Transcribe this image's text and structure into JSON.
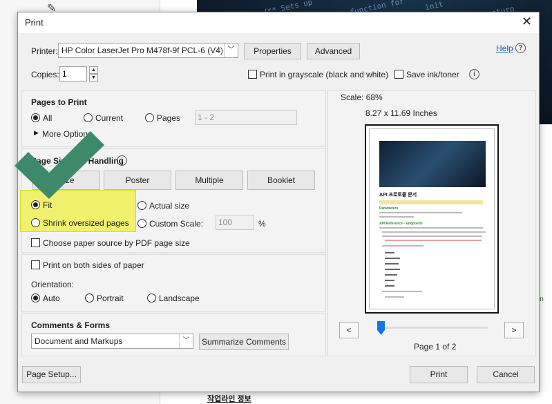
{
  "background": {
    "footer_link": "작업라인 정보",
    "right_text": "in",
    "code_lines": [
      "/** Sets up",
      "* this function for",
      "init",
      "return"
    ]
  },
  "dialog": {
    "title": "Print",
    "close_glyph": "✕"
  },
  "printer": {
    "label": "Printer:",
    "value": "HP Color LaserJet Pro M478f-9f PCL-6 (V4)",
    "properties_label": "Properties",
    "advanced_label": "Advanced",
    "help_label": "Help",
    "help_icon": "?"
  },
  "copies": {
    "label": "Copies:",
    "value": "1",
    "grayscale_label": "Print in grayscale (black and white)",
    "grayscale_checked": false,
    "save_ink_label": "Save ink/toner",
    "save_ink_checked": false,
    "info_icon": "i"
  },
  "pages_to_print": {
    "title": "Pages to Print",
    "all_label": "All",
    "current_label": "Current",
    "pages_label": "Pages",
    "pages_value": "1 - 2",
    "selected": "All",
    "more_options_label": "More Options"
  },
  "sizing": {
    "title": "Page Sizing & Handling",
    "info_icon": "i",
    "tabs": [
      "Size",
      "Poster",
      "Multiple",
      "Booklet"
    ],
    "fit_label": "Fit",
    "actual_size_label": "Actual size",
    "shrink_label": "Shrink oversized pages",
    "custom_scale_label": "Custom Scale:",
    "custom_scale_value": "100",
    "custom_scale_unit": "%",
    "selected": "Fit",
    "paper_source_label": "Choose paper source by PDF page size",
    "paper_source_checked": false
  },
  "duplex": {
    "both_sides_label": "Print on both sides of paper",
    "both_sides_checked": false,
    "orientation_label": "Orientation:",
    "auto_label": "Auto",
    "portrait_label": "Portrait",
    "landscape_label": "Landscape",
    "selected": "Auto"
  },
  "comments": {
    "title": "Comments & Forms",
    "value": "Document and Markups",
    "summarize_label": "Summarize Comments"
  },
  "preview": {
    "scale": "Scale:  68%",
    "size": "8.27 x 11.69 Inches",
    "page_indicator": "Page 1 of 2",
    "prev_label": "<",
    "next_label": ">",
    "position_fraction": 0.0,
    "doc_title": "API 프로토콜 문서",
    "doc_section1": "Parameters",
    "doc_section2": "API Reference - Endpoints"
  },
  "footer": {
    "page_setup_label": "Page Setup...",
    "print_label": "Print",
    "cancel_label": "Cancel"
  },
  "colors": {
    "highlight": "#f0f046",
    "checkmark": "#3d8a6a",
    "accent": "#1473e6",
    "link": "#2a5db0"
  }
}
